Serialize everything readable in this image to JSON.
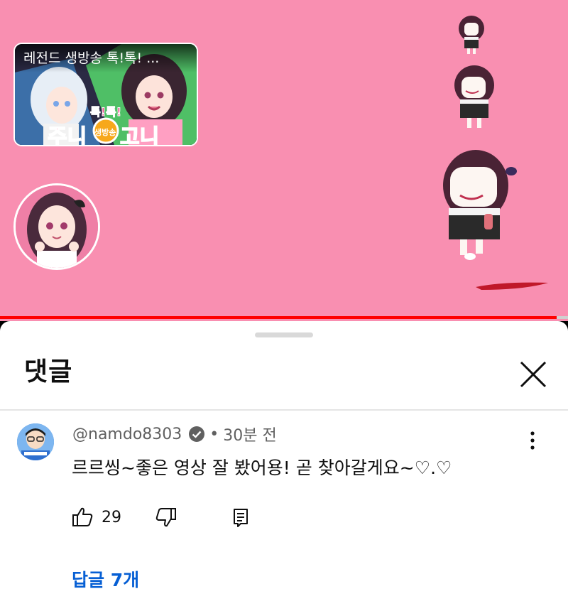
{
  "video": {
    "promo_card": {
      "title": "레전드 생방송 톡!톡! ...",
      "logo_left": "주니",
      "logo_right": "고니",
      "logo_badge": "생방송",
      "logo_top": "톡!톡!"
    },
    "progress_fraction": 0.98,
    "colors": {
      "background": "#f98fb1",
      "progress": "#ff0000"
    }
  },
  "comments_panel": {
    "title": "댓글",
    "close_icon": "close-icon",
    "comment": {
      "author": "@namdo8303",
      "verified_icon": "verified-check-icon",
      "separator": "•",
      "time": "30분 전",
      "text": "르르씽~좋은 영상 잘 봤어용! 곧 찾아갈게요~♡.♡",
      "like_count": "29",
      "icons": [
        "like-icon",
        "dislike-icon",
        "reply-icon",
        "more-vert-icon"
      ],
      "replies_label": "답글 7개"
    },
    "colors": {
      "link": "#065fd4",
      "meta": "#606060",
      "text": "#0f0f0f"
    }
  }
}
